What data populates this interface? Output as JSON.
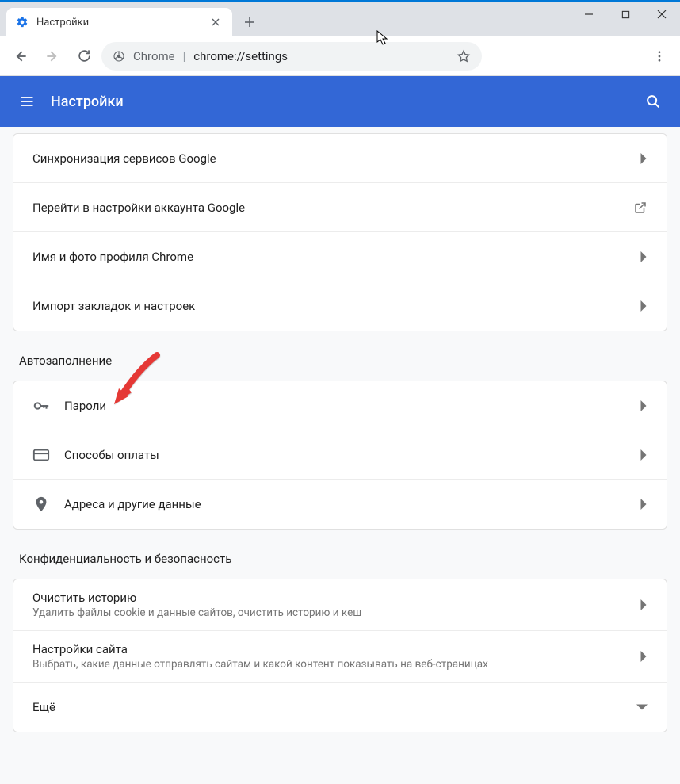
{
  "window": {
    "tab_title": "Настройки"
  },
  "omnibox": {
    "scheme_label": "Chrome",
    "url_path": "chrome://settings"
  },
  "appbar": {
    "title": "Настройки"
  },
  "sections": {
    "sync": {
      "rows": [
        {
          "label": "Синхронизация сервисов Google"
        },
        {
          "label": "Перейти в настройки аккаунта Google"
        },
        {
          "label": "Имя и фото профиля Chrome"
        },
        {
          "label": "Импорт закладок и настроек"
        }
      ]
    },
    "autofill": {
      "title": "Автозаполнение",
      "rows": [
        {
          "label": "Пароли"
        },
        {
          "label": "Способы оплаты"
        },
        {
          "label": "Адреса и другие данные"
        }
      ]
    },
    "privacy": {
      "title": "Конфиденциальность и безопасность",
      "rows": [
        {
          "label": "Очистить историю",
          "sub": "Удалить файлы cookie и данные сайтов, очистить историю и кеш"
        },
        {
          "label": "Настройки сайта",
          "sub": "Выбрать, какие данные отправлять сайтам и какой контент показывать на веб-страницах"
        },
        {
          "label": "Ещё"
        }
      ]
    }
  }
}
